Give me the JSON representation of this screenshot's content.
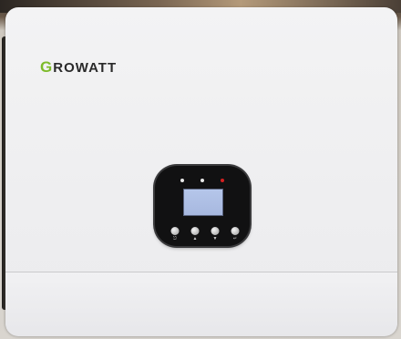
{
  "brand": {
    "logo_first_letter": "G",
    "logo_rest": "ROWATT",
    "logo_accent_color": "#7dbb2a"
  },
  "panel": {
    "leds": [
      {
        "name": "ac-bat-led",
        "color": "#e8e8e8"
      },
      {
        "name": "inv-led",
        "color": "#e8e8e8"
      },
      {
        "name": "fault-led",
        "color": "#d42020"
      }
    ],
    "buttons": [
      {
        "name": "esc-button",
        "symbol": "⎋"
      },
      {
        "name": "up-button",
        "symbol": "▲"
      },
      {
        "name": "down-button",
        "symbol": "▼"
      },
      {
        "name": "enter-button",
        "symbol": "↵"
      }
    ]
  }
}
